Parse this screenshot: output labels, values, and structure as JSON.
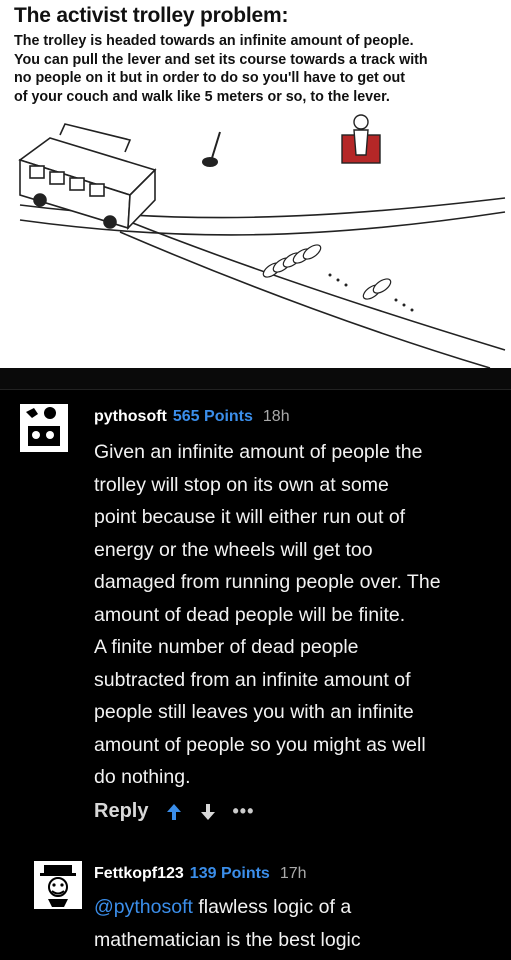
{
  "meme": {
    "title": "The activist trolley problem:",
    "lines": [
      "The trolley is headed towards an infinite amount of people.",
      "You can pull the lever and set its  course towards a track with",
      "no people on it  but in order to do so you'll have to get out",
      "of your couch  and walk  like  5 meters or so, to the lever."
    ]
  },
  "comments": [
    {
      "username": "pythosoft",
      "points": "565 Points",
      "time": "18h",
      "body_lines": [
        "Given an infinite amount of people the",
        "trolley will stop on its own at some",
        "point because it will either run out of",
        "energy or the wheels will get too",
        "damaged from running people over. The",
        "amount of dead people will be finite.",
        "A finite number of dead people",
        "subtracted from an infinite amount of",
        "people still leaves you with an infinite",
        "amount of people so you might as well",
        "do nothing."
      ],
      "reply_label": "Reply",
      "more_label": "•••"
    },
    {
      "username": "Fettkopf123",
      "points": "139 Points",
      "time": "17h",
      "mention": "@pythosoft",
      "body_first": " flawless logic of a",
      "body_second": "mathematician is the best logic"
    }
  ],
  "colors": {
    "accent": "#3b8eea",
    "background": "#000000",
    "upvote": "#3b8eea"
  }
}
